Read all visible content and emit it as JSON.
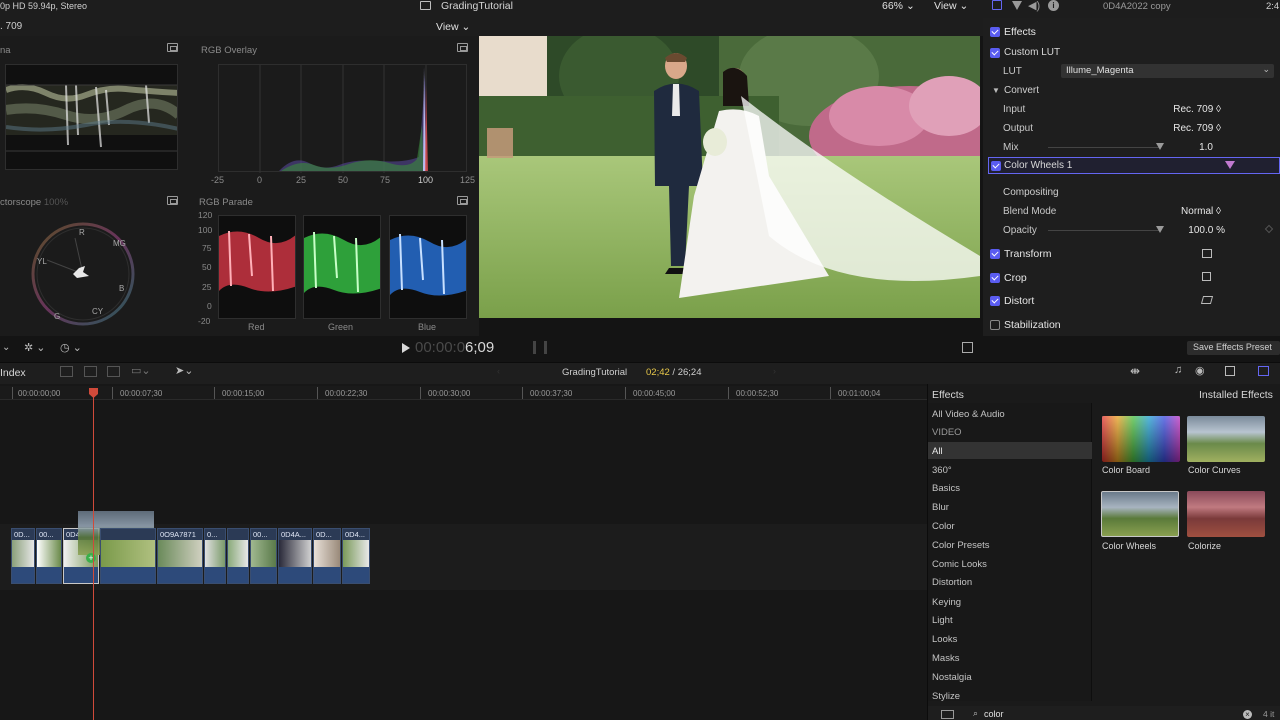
{
  "topbar": {
    "format": "0p HD 59.94p, Stereo",
    "project_title": "GradingTutorial",
    "zoom": "66%",
    "view_label": "View",
    "clip_name": "0D4A2022 copy",
    "right_timecode": "2:4"
  },
  "scopes": {
    "rec_label": ". 709",
    "viewer_view_label": "View",
    "waveform_label": "na",
    "rgb_overlay_label": "RGB Overlay",
    "rgb_overlay_ticks": [
      "-25",
      "0",
      "25",
      "50",
      "75",
      "100",
      "125"
    ],
    "vectorscope_label": "ctorscope",
    "vectorscope_pct": "100%",
    "vector_targets": [
      "R",
      "MG",
      "YL",
      "B",
      "G",
      "CY"
    ],
    "rgb_parade_label": "RGB Parade",
    "parade_ticks": [
      "120",
      "100",
      "75",
      "50",
      "25",
      "0",
      "-20"
    ],
    "parade_channels": [
      "Red",
      "Green",
      "Blue"
    ]
  },
  "viewer": {
    "timecode_dim": "00:00:0",
    "timecode_bright": "6;09"
  },
  "inspector": {
    "effects_label": "Effects",
    "custom_lut": "Custom LUT",
    "lut_label": "LUT",
    "lut_value": "Illume_Magenta",
    "convert_label": "Convert",
    "input_label": "Input",
    "input_value": "Rec. 709 ◊",
    "output_label": "Output",
    "output_value": "Rec. 709 ◊",
    "mix_label": "Mix",
    "mix_value": "1.0",
    "color_wheels": "Color Wheels 1",
    "compositing_label": "Compositing",
    "blend_label": "Blend Mode",
    "blend_value": "Normal ◊",
    "opacity_label": "Opacity",
    "opacity_value": "100.0 %",
    "transform_label": "Transform",
    "crop_label": "Crop",
    "distort_label": "Distort",
    "stabilization_label": "Stabilization",
    "save_preset": "Save Effects Preset"
  },
  "timeline": {
    "index_label": "Index",
    "project_name": "GradingTutorial",
    "position": "02;42",
    "duration": "/ 26;24",
    "ruler": [
      "00:00:00;00",
      "00:00:07;30",
      "00:00:15;00",
      "00:00:22;30",
      "00:00:30;00",
      "00:00:37;30",
      "00:00:45;00",
      "00:00:52;30",
      "00:01:00;04"
    ],
    "clips": [
      "0D...",
      "00...",
      "0D4",
      "",
      "0O9A7871",
      "0...",
      "00...",
      "0D4A...",
      "0D...",
      "0D4..."
    ]
  },
  "browser": {
    "header": "Effects",
    "installed": "Installed Effects",
    "categories": [
      "All Video & Audio",
      "VIDEO",
      "All",
      "360°",
      "Basics",
      "Blur",
      "Color",
      "Color Presets",
      "Comic Looks",
      "Distortion",
      "Keying",
      "Light",
      "Looks",
      "Masks",
      "Nostalgia",
      "Stylize"
    ],
    "effects": [
      "Color Board",
      "Color Curves",
      "Color Wheels",
      "Colorize"
    ],
    "search_value": "color",
    "count": "4 it"
  }
}
